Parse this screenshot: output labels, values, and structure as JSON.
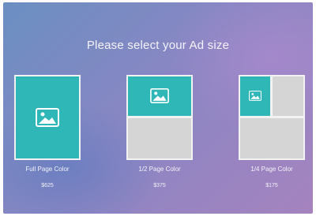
{
  "heading": "Please select your Ad size",
  "options": [
    {
      "label": "Full Page Color",
      "price": "$625",
      "icon": "image-icon"
    },
    {
      "label": "1/2 Page Color",
      "price": "$375",
      "icon": "image-icon"
    },
    {
      "label": "1/4 Page Color",
      "price": "$175",
      "icon": "image-icon"
    }
  ],
  "colors": {
    "accent_teal": "#2fb7b8",
    "placeholder_grey": "#d5d5d5",
    "card_border": "#f2f2f2"
  }
}
